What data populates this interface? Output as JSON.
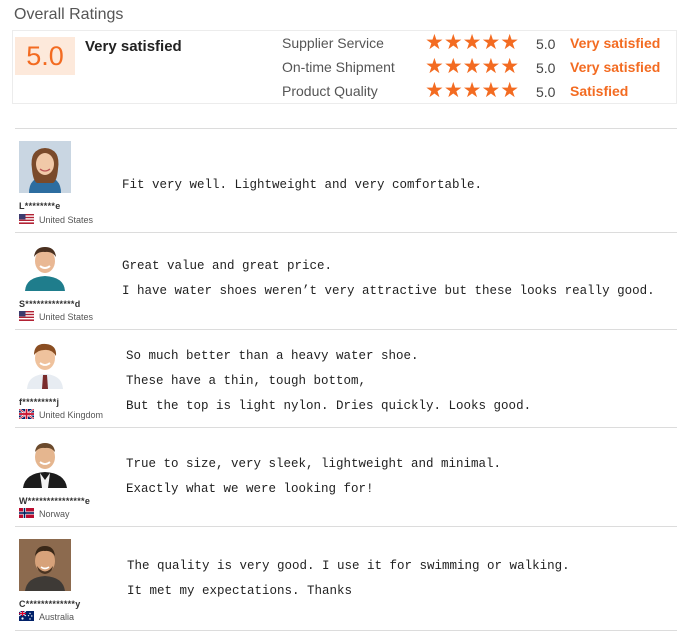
{
  "header": {
    "title": "Overall Ratings"
  },
  "summary": {
    "score": "5.0",
    "label": "Very satisfied"
  },
  "ratings": [
    {
      "label": "Supplier Service",
      "stars": 5,
      "value": "5.0",
      "word": "Very satisfied"
    },
    {
      "label": "On-time Shipment",
      "stars": 5,
      "value": "5.0",
      "word": "Very satisfied"
    },
    {
      "label": "Product Quality",
      "stars": 5,
      "value": "5.0",
      "word": "Satisfied"
    }
  ],
  "reviews": [
    {
      "user": "L********e",
      "country": "United States",
      "flag": "us",
      "lines": [
        "Fit very well. Lightweight and very comfortable."
      ]
    },
    {
      "user": "S*************d",
      "country": "United States",
      "flag": "us",
      "lines": [
        "Great value and great price.",
        "I have water shoes weren’t very attractive but these looks really good."
      ]
    },
    {
      "user": "f*********j",
      "country": "United Kingdom",
      "flag": "uk",
      "lines": [
        "So much better than a heavy water shoe.",
        "These have a thin, tough bottom,",
        "But the top is light nylon. Dries quickly. Looks good."
      ]
    },
    {
      "user": "W***************e",
      "country": "Norway",
      "flag": "no",
      "lines": [
        "True to size, very sleek, lightweight and minimal.",
        "Exactly what we were looking for!"
      ]
    },
    {
      "user": "C*************y",
      "country": "Australia",
      "flag": "au",
      "lines": [
        "The quality is very good. I use it for swimming or walking.",
        "It met my expectations. Thanks"
      ]
    }
  ],
  "colors": {
    "accent": "#f36b21",
    "badge_bg": "#fde9db"
  }
}
